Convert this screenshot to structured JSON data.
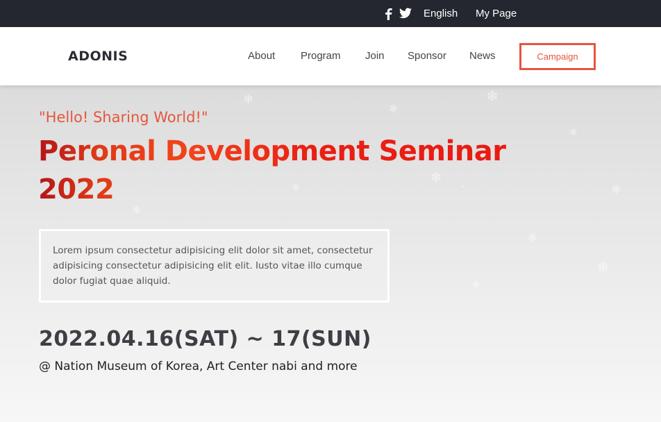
{
  "topbar": {
    "icons": [
      "facebook-icon",
      "twitter-icon"
    ],
    "links": {
      "english": "English",
      "my_page": "My Page"
    }
  },
  "header": {
    "logo": "ADONIS",
    "nav": {
      "about": "About",
      "program": "Program",
      "join": "Join",
      "sponsor": "Sponsor",
      "news": "News"
    },
    "campaign_button": "Campaign"
  },
  "hero": {
    "tagline": "\"Hello! Sharing World!\"",
    "title": "Peronal Development Seminar 2022",
    "description": "Lorem ipsum consectetur adipisicing elit dolor sit amet, consectetur adipisicing consectetur adipisicing elit elit. Iusto vitae illo cumque dolor fugiat quae aliquid.",
    "date": "2022.04.16(SAT) ~ 17(SUN)",
    "venue": "@ Nation Museum of Korea, Art Center nabi and more"
  },
  "colors": {
    "topbar_bg": "#242730",
    "accent": "#e4573d",
    "title_red": "#e91a12",
    "date_text": "#3e3e44"
  }
}
